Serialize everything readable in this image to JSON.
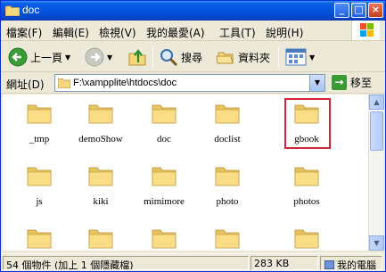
{
  "window": {
    "title": "doc"
  },
  "menu": [
    "檔案(F)",
    "編輯(E)",
    "檢視(V)",
    "我的最愛(A)",
    "工具(T)",
    "說明(H)"
  ],
  "toolbar": {
    "back_label": "上一頁",
    "search_label": "搜尋",
    "folders_label": "資料夾"
  },
  "address": {
    "label": "網址(D)",
    "path": "F:\\xampplite\\htdocs\\doc",
    "go_label": "移至"
  },
  "folders": [
    "_tmp",
    "demoShow",
    "doc",
    "doclist",
    "gbook",
    "js",
    "kiki",
    "mimimore",
    "photo",
    "photos"
  ],
  "highlighted_folder": "gbook",
  "status": {
    "objects": "54 個物件 (加上 1 個隱藏檔)",
    "size": "283 KB",
    "location": "我的電腦"
  },
  "colors": {
    "titlebar": "#0454e0",
    "highlight": "#d6213c",
    "folder": "#f5d77a"
  }
}
